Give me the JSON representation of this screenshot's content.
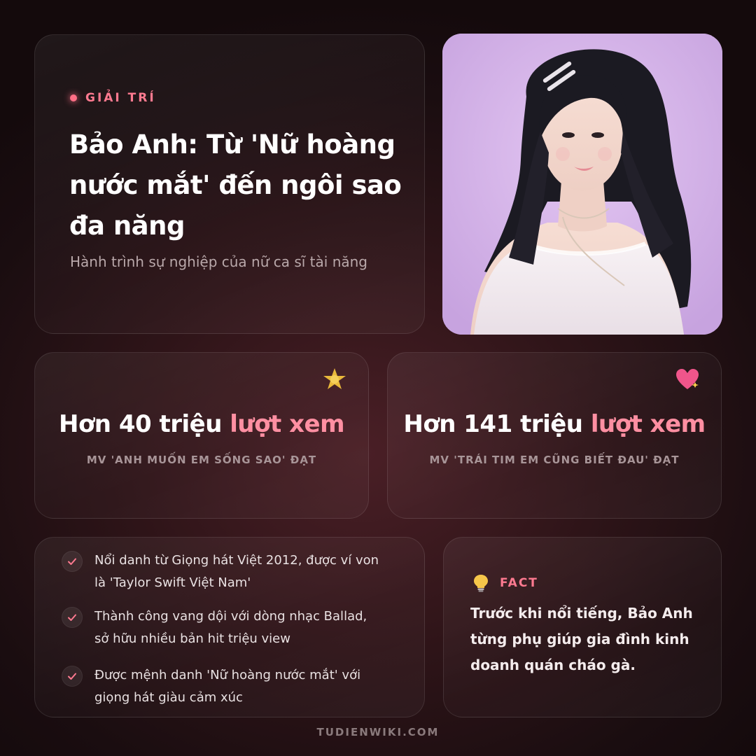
{
  "hero": {
    "category": "GIẢI TRÍ",
    "title_lines": [
      "Bảo Anh: Từ 'Nữ hoàng",
      "nước mắt' đến ngôi sao",
      "đa năng"
    ],
    "subtitle": "Hành trình sự nghiệp của nữ ca sĩ tài năng"
  },
  "photo": {
    "alt": "portrait-photo"
  },
  "stats": [
    {
      "icon": "sparkle-star-icon",
      "value_main": "Hơn 40 triệu",
      "value_accent": "lượt xem",
      "desc": "MV 'ANH MUỐN EM SỐNG SAO' ĐẠT"
    },
    {
      "icon": "sparkling-heart-icon",
      "value_main": "Hơn 141 triệu",
      "value_accent": "lượt xem",
      "desc": "MV 'TRÁI TIM EM CŨNG BIẾT ĐAU' ĐẠT"
    }
  ],
  "highlights": [
    {
      "line1": "Nổi danh từ Giọng hát Việt 2012, được ví von",
      "line2": "là 'Taylor Swift Việt Nam'"
    },
    {
      "line1": "Thành công vang dội với dòng nhạc Ballad,",
      "line2": "sở hữu nhiều bản hit triệu view"
    },
    {
      "line1": "Được mệnh danh 'Nữ hoàng nước mắt' với",
      "line2": "giọng hát giàu cảm xúc"
    }
  ],
  "fact": {
    "icon": "light-bulb-icon",
    "label": "FACT",
    "lines": [
      "Trước khi nổi tiếng, Bảo Anh",
      "từng phụ giúp gia đình kinh",
      "doanh quán cháo gà."
    ]
  },
  "footer": "TUDIENWIKI.COM",
  "colors": {
    "accent": "#ff7a90",
    "background": "#1a0d10"
  }
}
